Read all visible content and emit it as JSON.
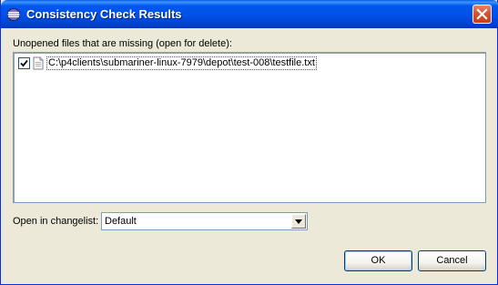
{
  "window": {
    "title": "Consistency Check Results",
    "title_icon": "eclipse-icon",
    "close_icon": "close-icon"
  },
  "missing_files": {
    "label": "Unopened files that are missing (open for delete):",
    "items": [
      {
        "checked": true,
        "icon": "file-icon",
        "path": "C:\\p4clients\\submariner-linux-7979\\depot\\test-008\\testfile.txt"
      }
    ]
  },
  "changelist": {
    "label": "Open in changelist:",
    "selected": "Default"
  },
  "buttons": {
    "ok": "OK",
    "cancel": "Cancel"
  },
  "colors": {
    "titlebar": "#0054e3",
    "window_bg": "#ece9d8",
    "close_button": "#d8532f",
    "list_border": "#7f9db9"
  }
}
